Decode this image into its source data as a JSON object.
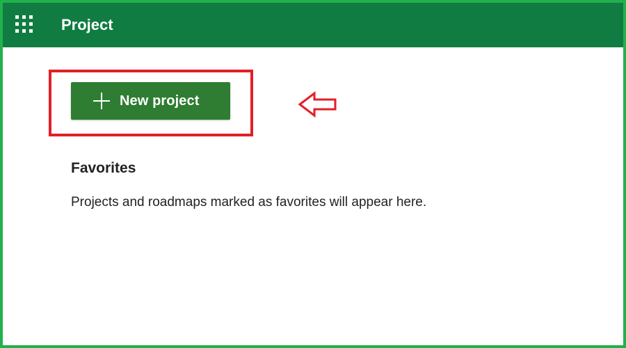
{
  "header": {
    "app_title": "Project",
    "waffle_icon": "app-launcher-icon",
    "background_color": "#107c41"
  },
  "main": {
    "new_project_button": {
      "label": "New project",
      "icon": "plus-icon",
      "background_color": "#2e7d32"
    },
    "favorites": {
      "title": "Favorites",
      "empty_message": "Projects and roadmaps marked as favorites will appear here."
    }
  },
  "annotations": {
    "highlight_color": "#e21f26",
    "arrow_icon": "left-arrow-icon",
    "frame_color": "#22b14c"
  }
}
